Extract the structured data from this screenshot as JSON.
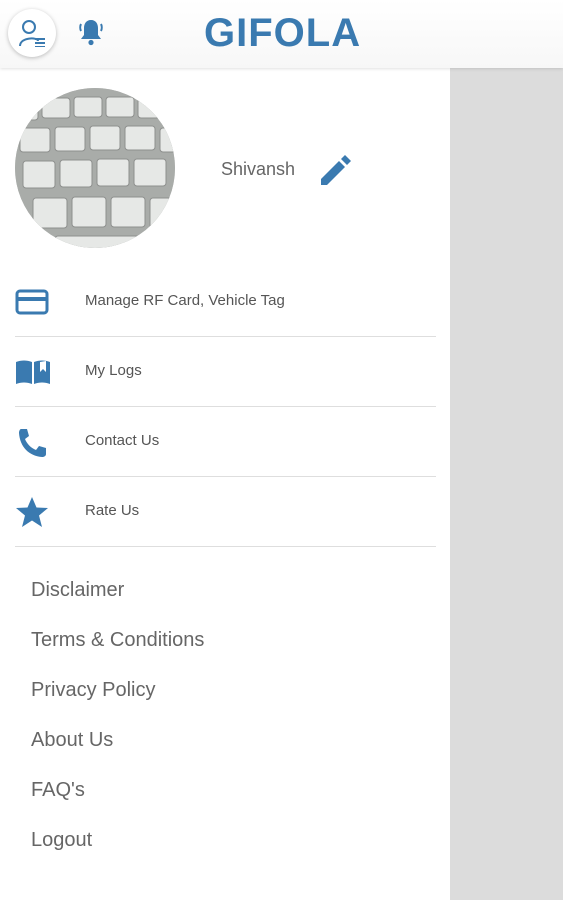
{
  "header": {
    "app_title": "GIFOLA",
    "profile_icon": "user-list-icon",
    "notification_icon": "bell-icon"
  },
  "drawer": {
    "user_name": "Shivansh",
    "edit_icon": "pencil-icon",
    "menu": [
      {
        "label": "Manage RF Card, Vehicle Tag",
        "icon": "credit-card-icon"
      },
      {
        "label": "My Logs",
        "icon": "book-icon"
      },
      {
        "label": "Contact Us",
        "icon": "phone-icon"
      },
      {
        "label": "Rate Us",
        "icon": "star-icon"
      }
    ],
    "links": [
      "Disclaimer",
      "Terms & Conditions",
      "Privacy Policy",
      "About Us",
      "FAQ's",
      "Logout"
    ]
  },
  "colors": {
    "accent": "#3a7ab0",
    "text_primary": "#666666",
    "divider": "#dedede",
    "scrim": "#dcdcdc"
  }
}
